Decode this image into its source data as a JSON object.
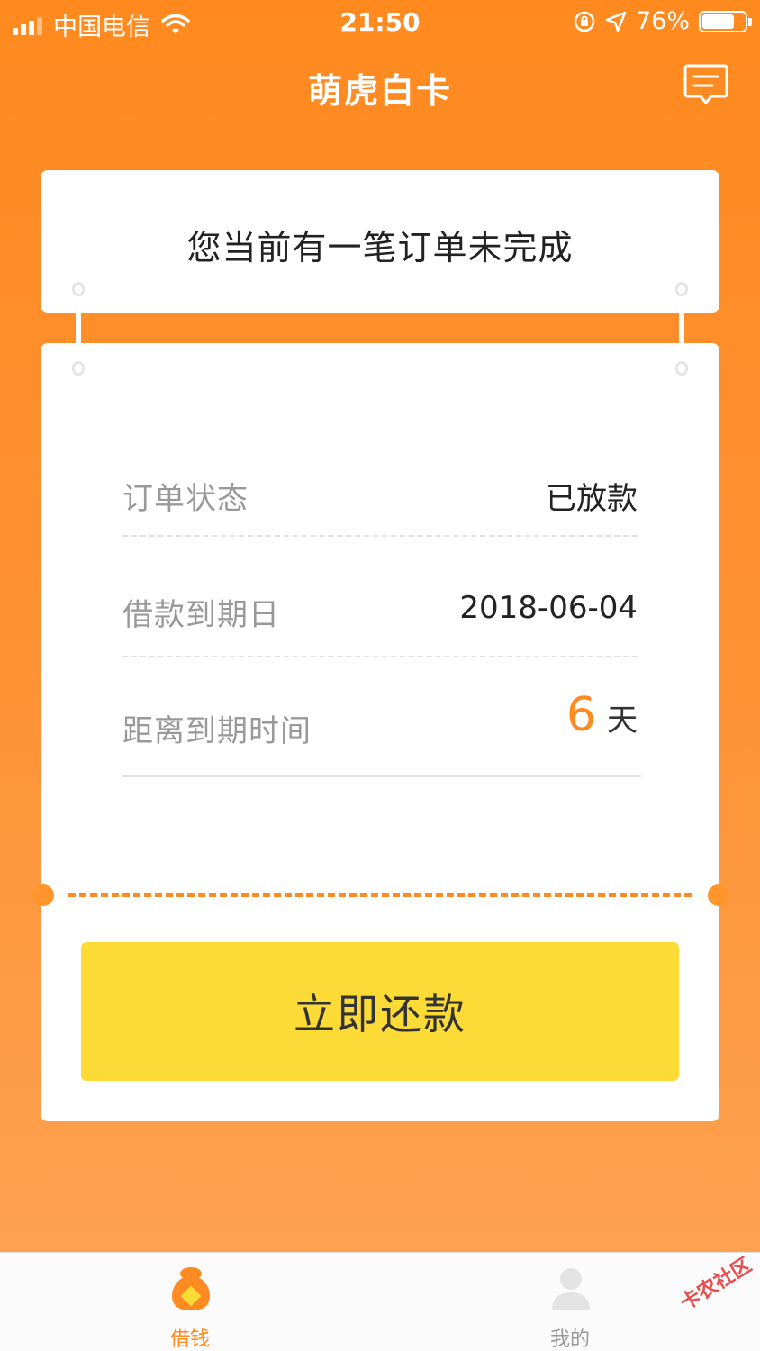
{
  "status_bar": {
    "carrier": "中国电信",
    "time": "21:50",
    "battery": "76%",
    "battery_level": 0.76
  },
  "header": {
    "title": "萌虎白卡",
    "message_icon": "chat-bubble-icon"
  },
  "notice": {
    "text": "您当前有一笔订单未完成"
  },
  "details": {
    "status_label": "订单状态",
    "status_value": "已放款",
    "due_label": "借款到期日",
    "due_value": "2018-06-04",
    "remaining_label": "距离到期时间",
    "remaining_days": "6",
    "remaining_unit": "天"
  },
  "actions": {
    "repay_label": "立即还款"
  },
  "tabs": [
    {
      "label": "借钱",
      "icon": "money-bag-icon",
      "active": true
    },
    {
      "label": "我的",
      "icon": "user-icon",
      "active": false
    }
  ],
  "watermark": "卡农社区",
  "colors": {
    "accent": "#fe8a22",
    "button": "#fddb37",
    "tab_active": "#fe8a22",
    "tab_inactive": "#999999"
  }
}
